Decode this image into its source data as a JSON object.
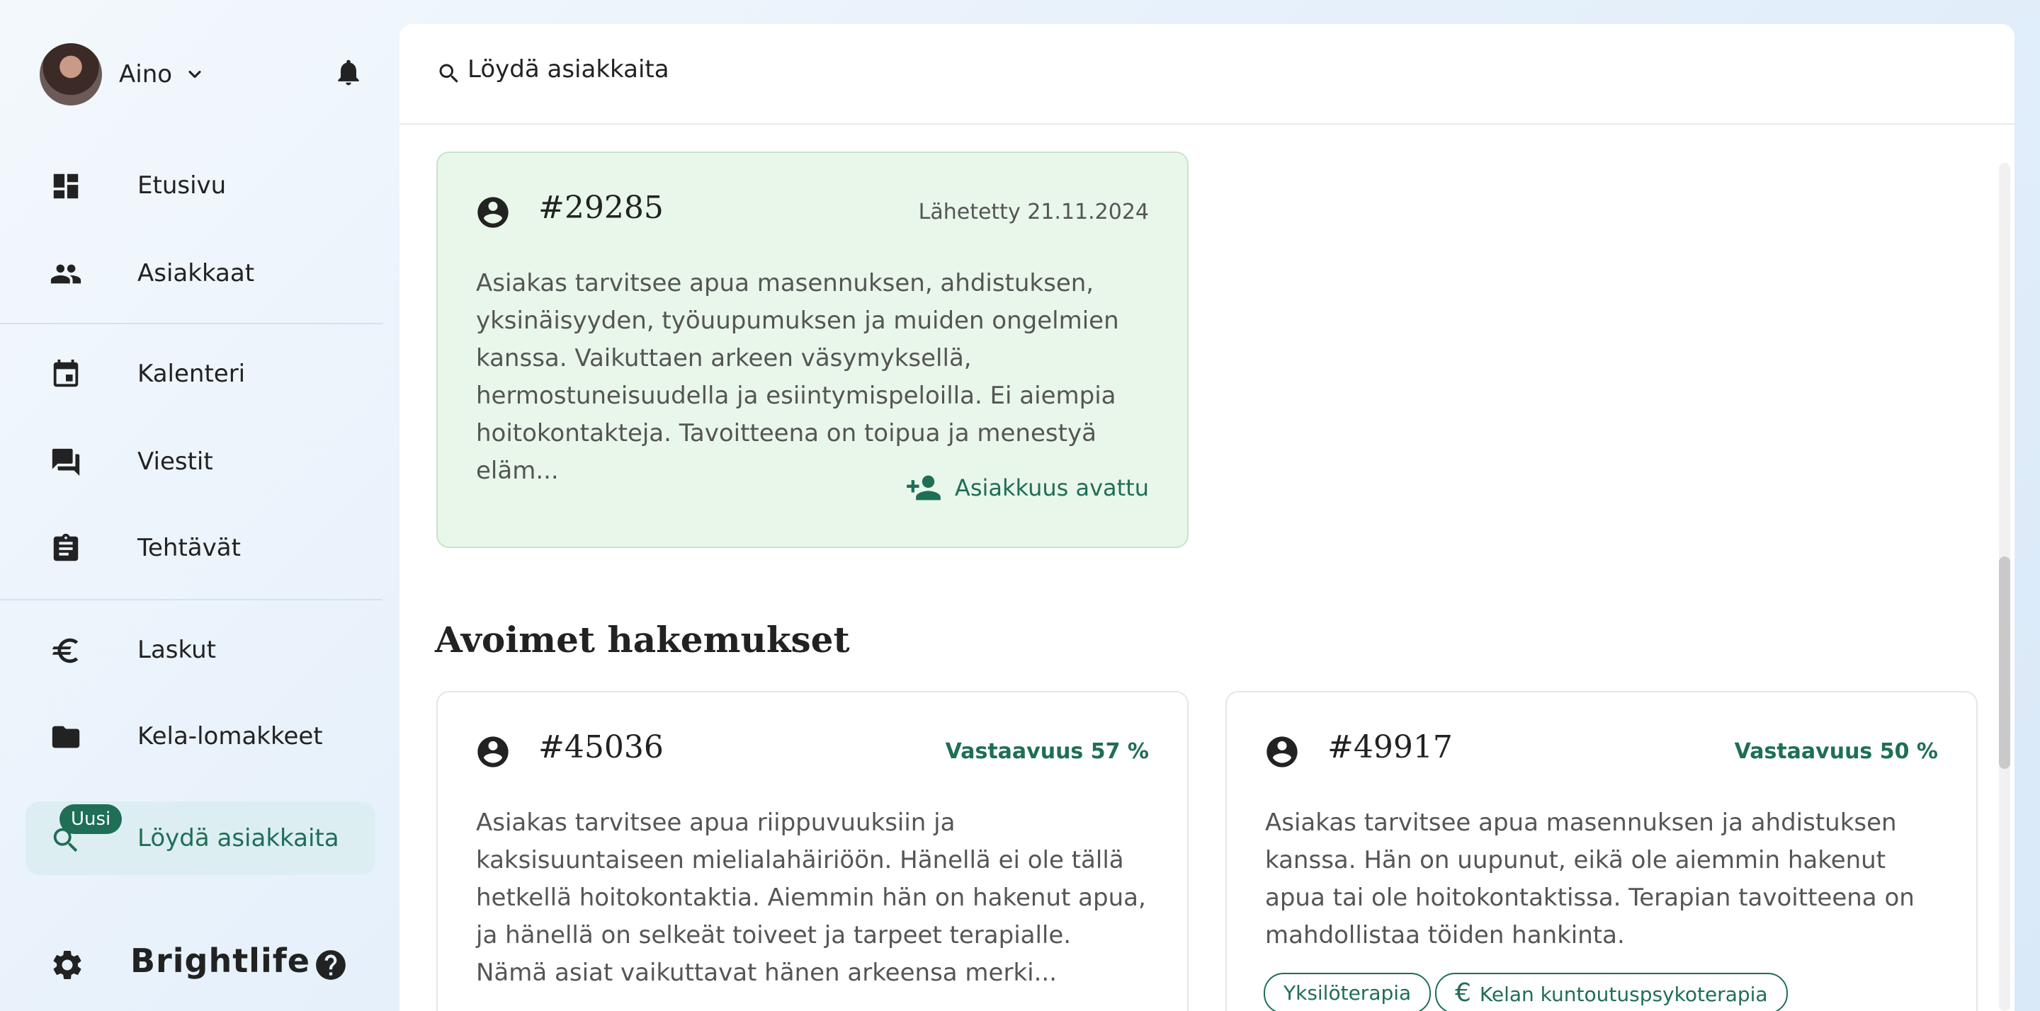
{
  "user": {
    "name": "Aino",
    "avatar_icon": "avatar-photo"
  },
  "nav": [
    {
      "label": "Etusivu",
      "icon": "dashboard-icon"
    },
    {
      "label": "Asiakkaat",
      "icon": "people-icon"
    },
    {
      "label": "Kalenteri",
      "icon": "calendar-icon"
    },
    {
      "label": "Viestit",
      "icon": "chat-icon"
    },
    {
      "label": "Tehtävät",
      "icon": "clipboard-icon"
    },
    {
      "label": "Laskut",
      "icon": "euro-icon"
    },
    {
      "label": "Kela-lomakkeet",
      "icon": "folder-icon"
    },
    {
      "label": "Löydä asiakkaita",
      "icon": "search-person-icon",
      "badge": "Uusi",
      "active": true
    }
  ],
  "brand": "Brightlife",
  "header": {
    "title": "Löydä asiakkaita"
  },
  "accepted_card": {
    "id": "#29285",
    "meta": "Lähetetty 21.11.2024",
    "text": "Asiakas tarvitsee apua masennuksen, ahdistuksen, yksinäisyyden, työuupumuksen ja muiden ongelmien kanssa. Vaikuttaen arkeen väsymyksellä, hermostuneisuudella ja esiintymispeloilla. Ei aiempia hoitokontakteja. Tavoitteena on toipua ja menestyä eläm...",
    "action": "Asiakkuus avattu"
  },
  "open_section": {
    "title": "Avoimet hakemukset"
  },
  "open_cards": [
    {
      "id": "#45036",
      "meta": "Vastaavuus 57 %",
      "text": "Asiakas tarvitsee apua riippuvuuksiin ja kaksisuuntaiseen mielialahäiriöön. Hänellä ei ole tällä hetkellä hoitokontaktia. Aiemmin hän on hakenut apua, ja hänellä on selkeät toiveet ja tarpeet terapialle. Nämä asiat vaikuttavat hänen arkeensa merki..."
    },
    {
      "id": "#49917",
      "meta": "Vastaavuus 50 %",
      "text": "Asiakas tarvitsee apua masennuksen ja ahdistuksen kanssa. Hän on uupunut, eikä ole aiemmin hakenut apua tai ole hoitokontaktissa. Terapian tavoitteena on mahdollistaa töiden hankinta.",
      "tags": [
        "Yksilöterapia",
        "Kelan kuntoutuspsykoterapia"
      ]
    }
  ],
  "colors": {
    "accent": "#1f6e56",
    "accepted_bg": "#e9f7ea",
    "active_nav_bg": "#ddeef3"
  }
}
